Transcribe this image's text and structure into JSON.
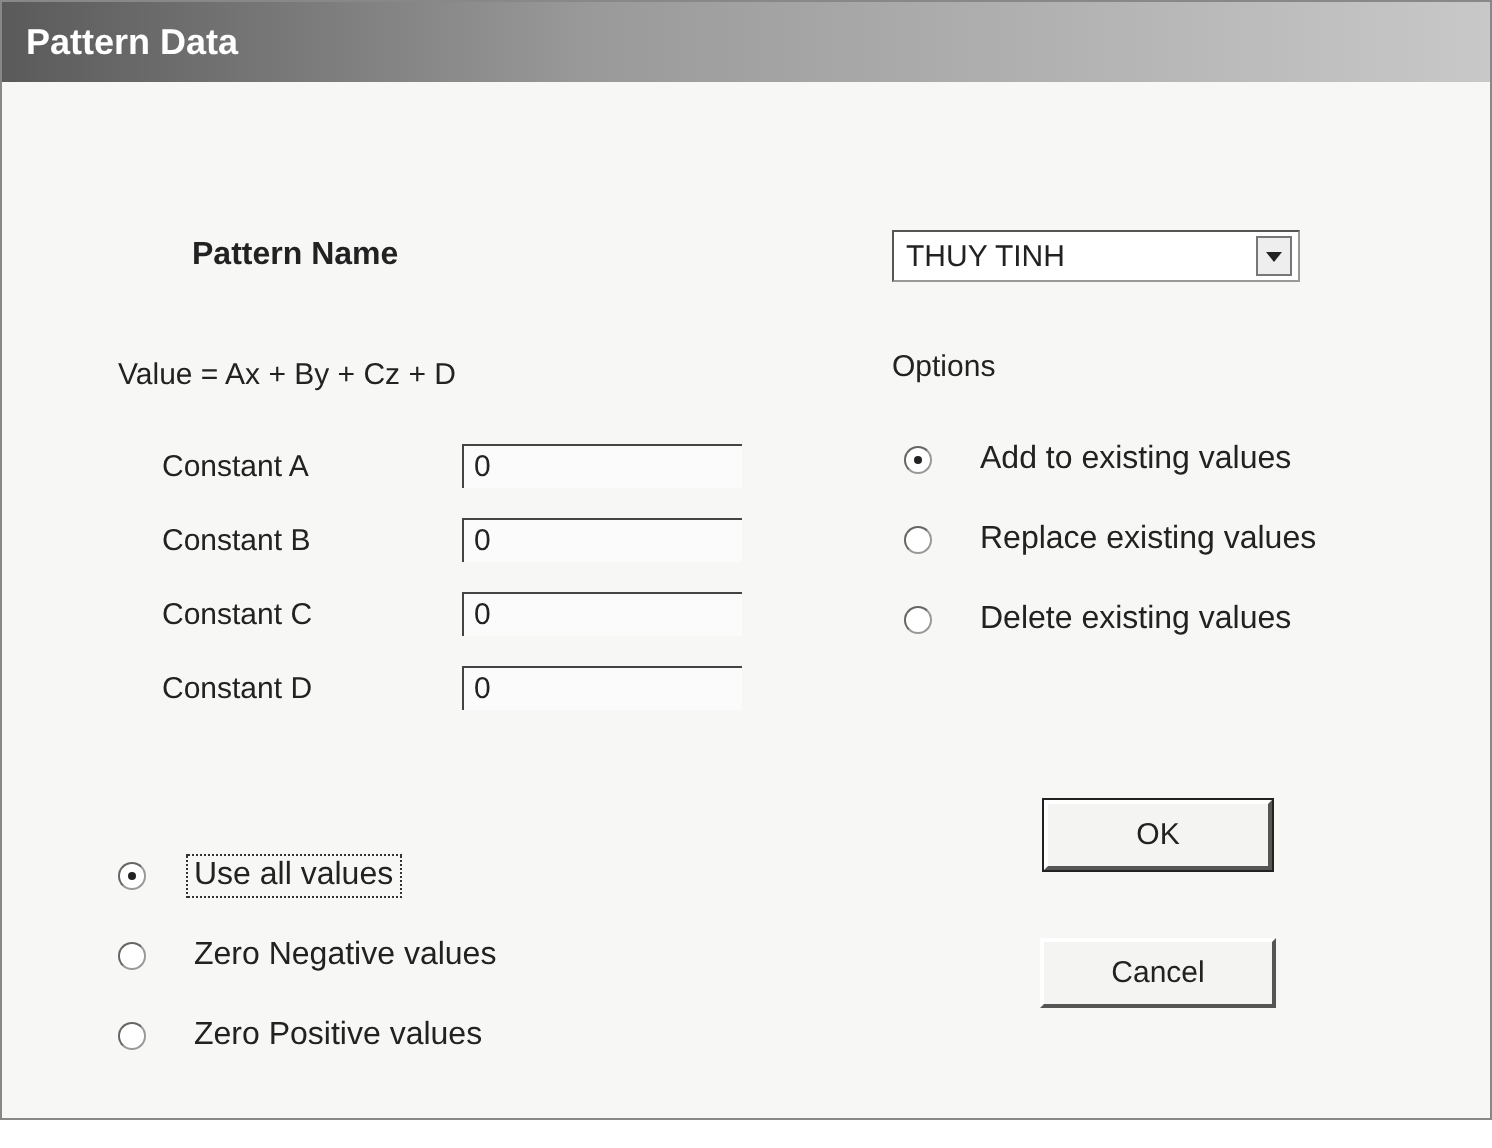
{
  "window": {
    "title": "Pattern Data"
  },
  "pattern_name": {
    "label": "Pattern Name",
    "value": "THUY TINH"
  },
  "formula": "Value = Ax + By + Cz + D",
  "constants": [
    {
      "label": "Constant A",
      "value": "0"
    },
    {
      "label": "Constant B",
      "value": "0"
    },
    {
      "label": "Constant C",
      "value": "0"
    },
    {
      "label": "Constant D",
      "value": "0"
    }
  ],
  "options": {
    "label": "Options",
    "items": [
      {
        "label": "Add to existing values",
        "selected": true
      },
      {
        "label": "Replace existing values",
        "selected": false
      },
      {
        "label": "Delete existing values",
        "selected": false
      }
    ]
  },
  "value_filters": [
    {
      "label": "Use all values",
      "selected": true,
      "focused": true
    },
    {
      "label": "Zero Negative values",
      "selected": false,
      "focused": false
    },
    {
      "label": "Zero Positive values",
      "selected": false,
      "focused": false
    }
  ],
  "buttons": [
    {
      "label": "OK",
      "default": true
    },
    {
      "label": "Cancel",
      "default": false
    }
  ]
}
